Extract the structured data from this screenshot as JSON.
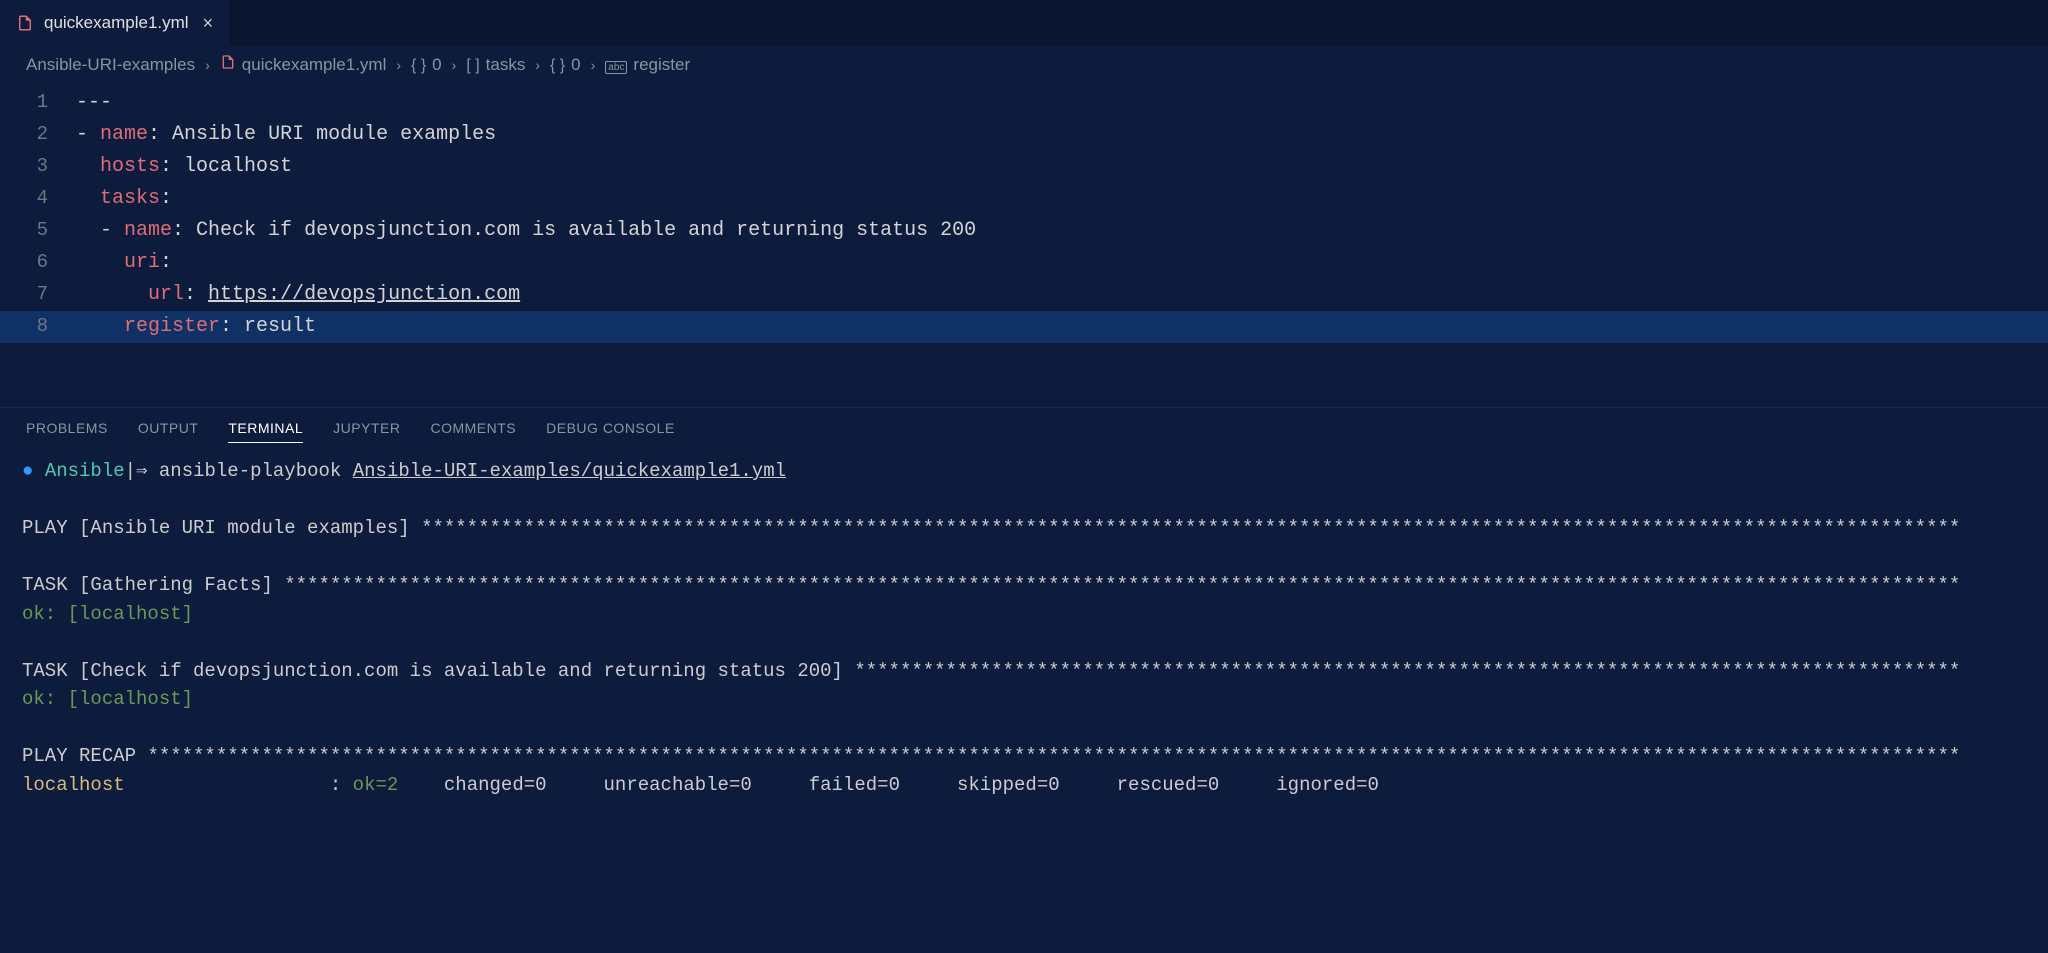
{
  "tab": {
    "filename": "quickexample1.yml"
  },
  "breadcrumbs": [
    {
      "label": "Ansible-URI-examples",
      "icon": ""
    },
    {
      "label": "quickexample1.yml",
      "icon": "file"
    },
    {
      "label": "0",
      "icon": "braces"
    },
    {
      "label": "tasks",
      "icon": "brackets"
    },
    {
      "label": "0",
      "icon": "braces"
    },
    {
      "label": "register",
      "icon": "abc"
    }
  ],
  "editor": {
    "lines": [
      {
        "num": "1",
        "seg": [
          {
            "t": "---",
            "c": "str"
          }
        ]
      },
      {
        "num": "2",
        "seg": [
          {
            "t": "- ",
            "c": "punct"
          },
          {
            "t": "name",
            "c": "key"
          },
          {
            "t": ": ",
            "c": "punct"
          },
          {
            "t": "Ansible URI module examples",
            "c": "str"
          }
        ]
      },
      {
        "num": "3",
        "seg": [
          {
            "t": "  "
          },
          {
            "t": "hosts",
            "c": "key"
          },
          {
            "t": ": ",
            "c": "punct"
          },
          {
            "t": "localhost",
            "c": "str"
          }
        ]
      },
      {
        "num": "4",
        "seg": [
          {
            "t": "  "
          },
          {
            "t": "tasks",
            "c": "key"
          },
          {
            "t": ":",
            "c": "punct"
          }
        ]
      },
      {
        "num": "5",
        "seg": [
          {
            "t": "  - "
          },
          {
            "t": "name",
            "c": "key"
          },
          {
            "t": ": ",
            "c": "punct"
          },
          {
            "t": "Check if devopsjunction.com is available and returning status 200",
            "c": "str"
          }
        ]
      },
      {
        "num": "6",
        "seg": [
          {
            "t": "    "
          },
          {
            "t": "uri",
            "c": "key"
          },
          {
            "t": ":",
            "c": "punct"
          }
        ]
      },
      {
        "num": "7",
        "seg": [
          {
            "t": "      "
          },
          {
            "t": "url",
            "c": "key"
          },
          {
            "t": ": ",
            "c": "punct"
          },
          {
            "t": "https://devopsjunction.com",
            "c": "link"
          }
        ]
      },
      {
        "num": "8",
        "hl": true,
        "seg": [
          {
            "t": "    "
          },
          {
            "t": "register",
            "c": "key"
          },
          {
            "t": ": ",
            "c": "punct"
          },
          {
            "t": "result",
            "c": "str"
          }
        ]
      }
    ]
  },
  "panel": {
    "tabs": [
      "PROBLEMS",
      "OUTPUT",
      "TERMINAL",
      "JUPYTER",
      "COMMENTS",
      "DEBUG CONSOLE"
    ],
    "active": "TERMINAL"
  },
  "terminal": {
    "prompt_env": "Ansible",
    "prompt_sep": "|⇒ ",
    "command": "ansible-playbook ",
    "command_arg": "Ansible-URI-examples/quickexample1.yml",
    "play_header": "PLAY [Ansible URI module examples] ",
    "task1_header": "TASK [Gathering Facts] ",
    "task1_status": "ok: [localhost]",
    "task2_header": "TASK [Check if devopsjunction.com is available and returning status 200] ",
    "task2_status": "ok: [localhost]",
    "recap_header": "PLAY RECAP ",
    "recap_host": "localhost",
    "recap_colon": ": ",
    "recap_ok": "ok=2   ",
    "recap_changed": "changed=0   ",
    "recap_unreachable": "unreachable=0   ",
    "recap_failed": "failed=0   ",
    "recap_skipped": "skipped=0   ",
    "recap_rescued": "rescued=0   ",
    "recap_ignored": "ignored=0"
  }
}
